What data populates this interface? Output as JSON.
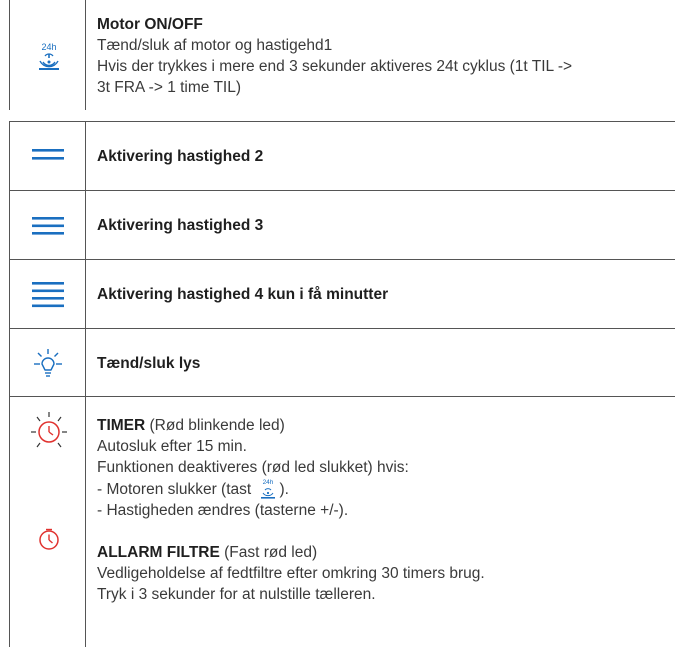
{
  "rows": [
    {
      "icon": "fan-24h-icon",
      "icon_label": "24h",
      "title": "Motor ON/OFF",
      "lines": [
        "Tænd/sluk af motor og hastigehd1",
        "Hvis der trykkes i mere end 3 sekunder aktiveres 24t cyklus (1t TIL ->",
        "3t FRA -> 1 time TIL)"
      ]
    },
    {
      "icon": "speed-2-lines-icon",
      "title": "Aktivering hastighed 2"
    },
    {
      "icon": "speed-3-lines-icon",
      "title": "Aktivering hastighed 3"
    },
    {
      "icon": "speed-4-lines-icon",
      "title": "Aktivering hastighed 4 kun i få minutter"
    },
    {
      "icon": "light-bulb-icon",
      "title": "Tænd/sluk lys"
    },
    {
      "icons": [
        "timer-blinking-icon",
        "timer-icon"
      ],
      "timer_title": "TIMER",
      "timer_note": " (Rød blinkende led)",
      "timer_lines": [
        "Autosluk efter 15 min.",
        "Funktionen deaktiveres (rød led slukket) hvis:"
      ],
      "timer_bullet1_a": "- Motoren slukker (tast ",
      "timer_bullet1_b": ").",
      "timer_bullet2": "- Hastigheden ændres (tasterne +/-).",
      "alarm_title": "ALLARM FILTRE",
      "alarm_note": " (Fast rød led)",
      "alarm_lines": [
        "Vedligeholdelse af fedtfiltre efter omkring 30 timers brug.",
        "Tryk i 3 sekunder for at nulstille tælleren."
      ]
    }
  ],
  "colors": {
    "icon_blue": "#1a6fc0",
    "icon_red": "#e0322f",
    "border": "#555555"
  }
}
